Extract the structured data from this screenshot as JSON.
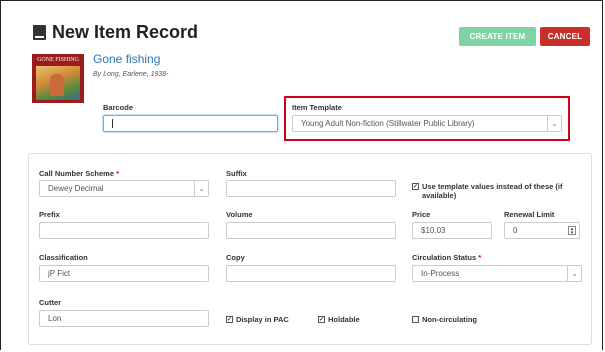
{
  "header": {
    "title": "New Item Record"
  },
  "actions": {
    "create_label": "CREATE ITEM",
    "cancel_label": "CANCEL"
  },
  "book": {
    "cover_text": "GONE FISHING",
    "title": "Gone fishing",
    "author": "By Long, Earlene, 1938-"
  },
  "top_fields": {
    "barcode_label": "Barcode",
    "barcode_value": "",
    "template_label": "Item Template",
    "template_value": "Young Adult Non-fiction (Stillwater Public Library)"
  },
  "form": {
    "call_number_scheme_label": "Call Number Scheme",
    "required_mark": "*",
    "call_number_scheme_value": "Dewey Decimal",
    "suffix_label": "Suffix",
    "suffix_value": "",
    "use_template_label": "Use template values instead of these (if available)",
    "use_template_checked": true,
    "prefix_label": "Prefix",
    "prefix_value": "",
    "volume_label": "Volume",
    "volume_value": "",
    "price_label": "Price",
    "price_value": "$10.03",
    "renewal_limit_label": "Renewal Limit",
    "renewal_limit_value": "0",
    "classification_label": "Classification",
    "classification_value": "jP Fict",
    "copy_label": "Copy",
    "copy_value": "",
    "circulation_status_label": "Circulation Status",
    "circulation_status_value": "In-Process",
    "cutter_label": "Cutter",
    "cutter_value": "Lon",
    "display_in_pac_label": "Display in PAC",
    "display_in_pac_checked": true,
    "holdable_label": "Holdable",
    "holdable_checked": true,
    "non_circulating_label": "Non-circulating",
    "non_circulating_checked": false
  },
  "icons": {
    "title_icon": "book-icon",
    "select_icon": "chevron-down-icon",
    "spinner_icon": "spinner-icon"
  },
  "colors": {
    "accent": "#2a7ab0",
    "create": "#7fd4a6",
    "cancel": "#c9302c",
    "highlight": "#d0021b"
  }
}
